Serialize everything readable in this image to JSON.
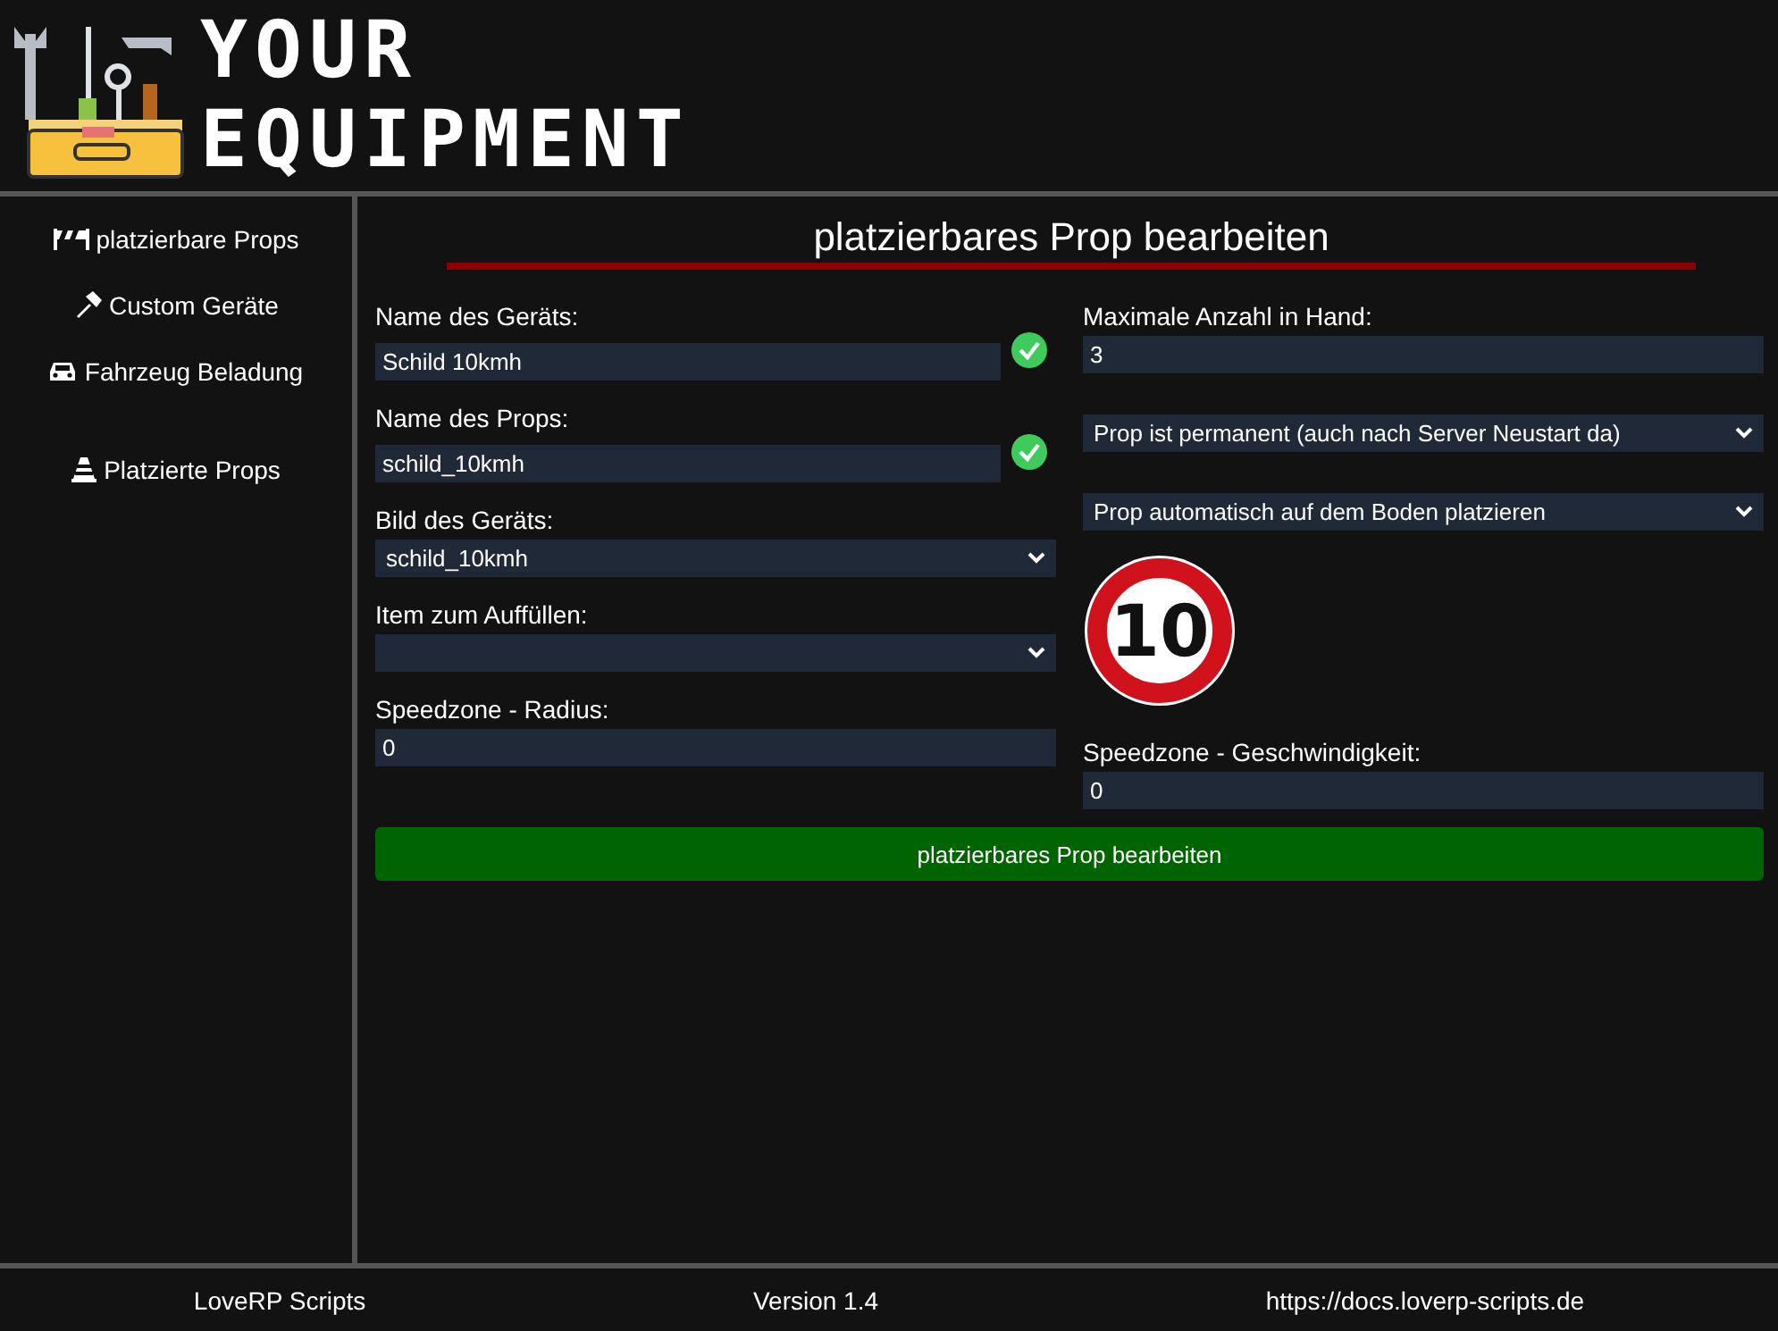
{
  "logo": {
    "line1": "YOUR",
    "line2": "EQUIPMENT"
  },
  "sidebar": {
    "items": [
      {
        "label": "platzierbare Props",
        "kind": "barrier",
        "selected": false
      },
      {
        "label": "Custom Geräte",
        "kind": "hammer",
        "selected": false
      },
      {
        "label": "Fahrzeug Beladung",
        "kind": "car",
        "selected": false
      },
      {
        "label": "Platzierte Props",
        "kind": "cone",
        "selected": false
      }
    ]
  },
  "form": {
    "title": "platzierbares Prop bearbeiten",
    "left": [
      {
        "kind": "text",
        "label": "Name des Geräts:",
        "value": "Schild 10kmh",
        "valid": true
      },
      {
        "kind": "text",
        "label": "Name des Props:",
        "value": "schild_10kmh",
        "valid": true
      },
      {
        "kind": "select",
        "label": "Bild des Geräts:",
        "value": "schild_10kmh"
      },
      {
        "kind": "select",
        "label": "Item zum Auffüllen:"
      },
      {
        "kind": "text",
        "label": "Speedzone - Radius:",
        "value": "0"
      }
    ],
    "right": [
      {
        "kind": "text",
        "label": "Maximale Anzahl in Hand:",
        "value": "3"
      },
      {
        "kind": "select",
        "value": "Prop ist permanent (auch nach Server Neustart da)"
      },
      {
        "kind": "select",
        "value": "Prop automatisch auf dem Boden platzieren"
      },
      {
        "kind": "image",
        "sign_text": "10"
      },
      {
        "kind": "text",
        "label": "Speedzone - Geschwindigkeit:",
        "value": "0"
      }
    ],
    "submit": "platzierbares Prop bearbeiten"
  },
  "footer": [
    "LoveRP Scripts",
    "Version 1.4",
    "https://docs.loverp-scripts.de"
  ]
}
